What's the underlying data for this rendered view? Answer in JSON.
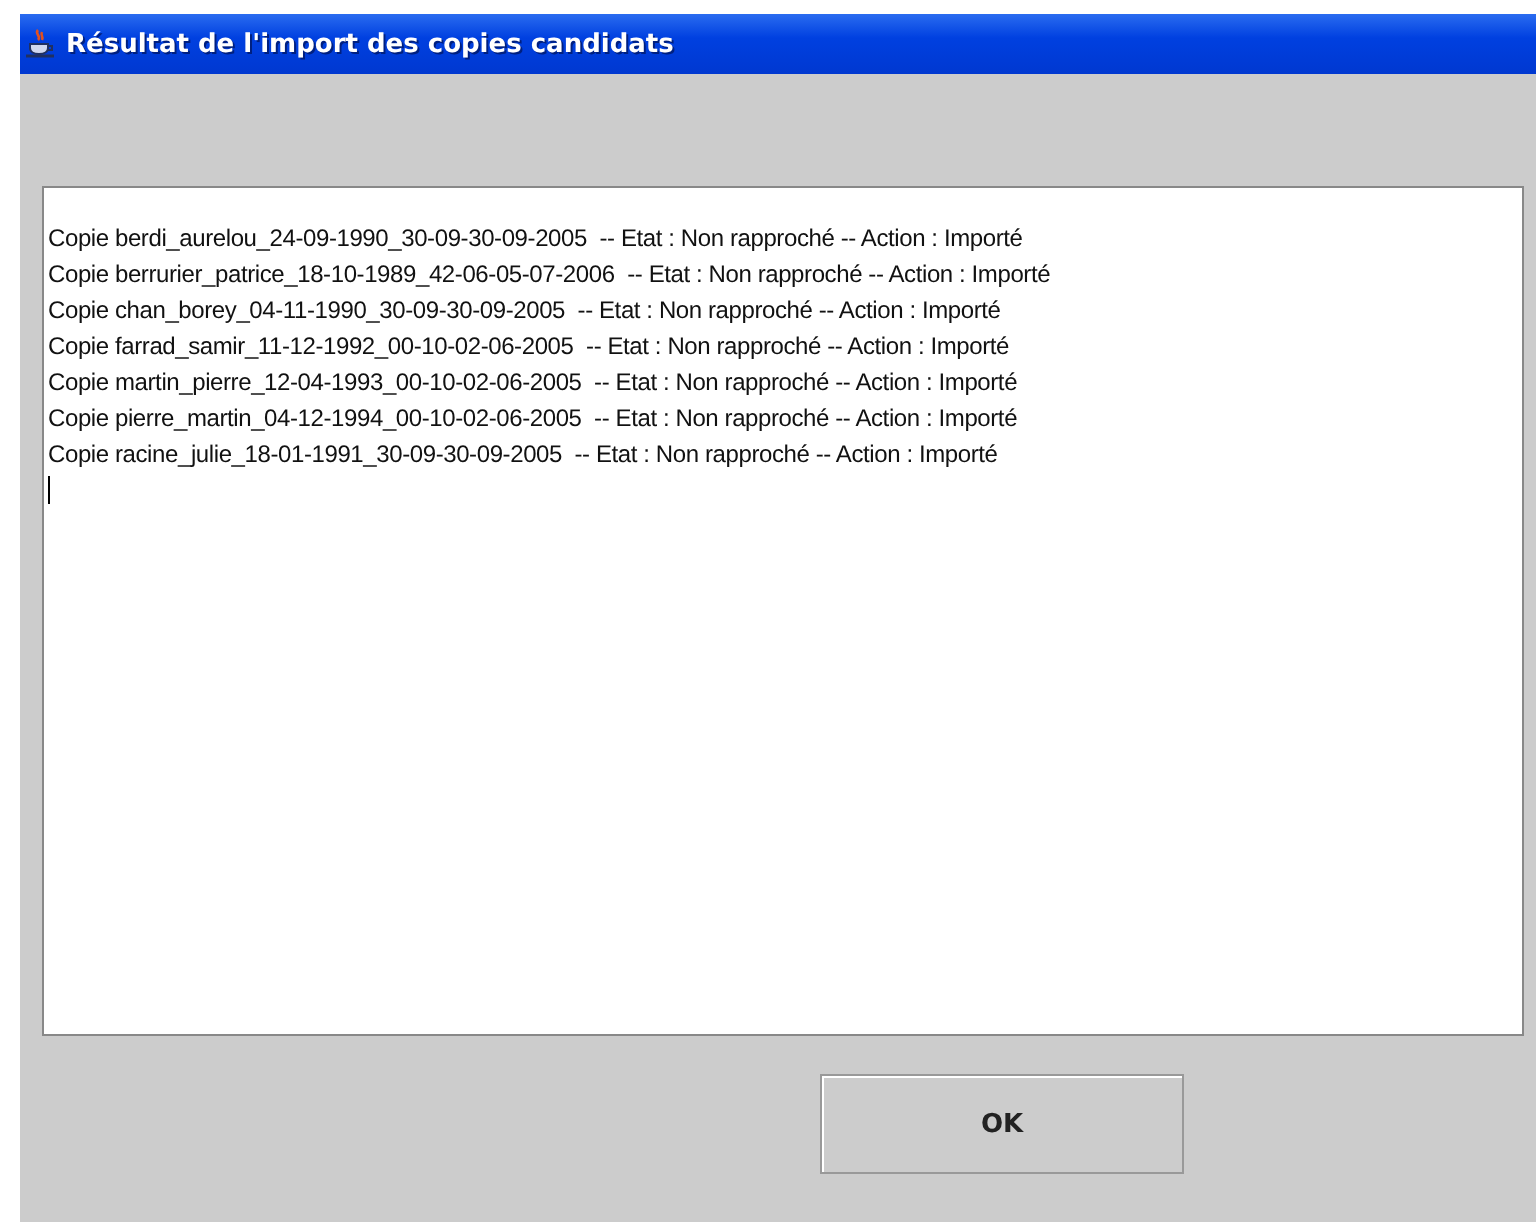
{
  "window": {
    "title": "Résultat de l'import des copies candidats"
  },
  "log_lines": [
    "Copie berdi_aurelou_24-09-1990_30-09-30-09-2005  -- Etat : Non rapproché -- Action : Importé",
    "Copie berrurier_patrice_18-10-1989_42-06-05-07-2006  -- Etat : Non rapproché -- Action : Importé",
    "Copie chan_borey_04-11-1990_30-09-30-09-2005  -- Etat : Non rapproché -- Action : Importé",
    "Copie farrad_samir_11-12-1992_00-10-02-06-2005  -- Etat : Non rapproché -- Action : Importé",
    "Copie martin_pierre_12-04-1993_00-10-02-06-2005  -- Etat : Non rapproché -- Action : Importé",
    "Copie pierre_martin_04-12-1994_00-10-02-06-2005  -- Etat : Non rapproché -- Action : Importé",
    "Copie racine_julie_18-01-1991_30-09-30-09-2005  -- Etat : Non rapproché -- Action : Importé"
  ],
  "buttons": [
    "OK"
  ]
}
